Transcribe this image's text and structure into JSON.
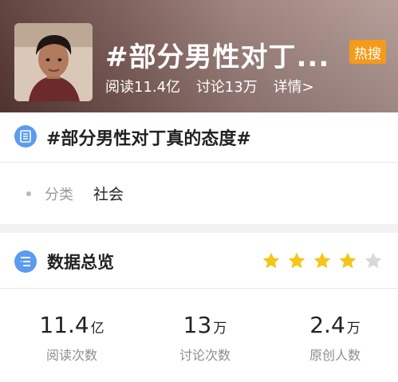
{
  "header": {
    "title": "#部分男性对丁...",
    "badge": "热搜",
    "reads": "阅读11.4亿",
    "discussions": "讨论13万",
    "details": "详情>"
  },
  "topic": {
    "name": "#部分男性对丁真的态度#",
    "category_label": "分类",
    "category_value": "社会"
  },
  "overview": {
    "title": "数据总览",
    "rating": {
      "filled": 4,
      "total": 5
    },
    "metrics": [
      {
        "value": "11.4",
        "unit": "亿",
        "label": "阅读次数"
      },
      {
        "value": "13",
        "unit": "万",
        "label": "讨论次数"
      },
      {
        "value": "2.4",
        "unit": "万",
        "label": "原创人数"
      }
    ]
  },
  "colors": {
    "accent": "#5b9bf0",
    "badge": "#f59a1b",
    "star_on": "#f5c518",
    "star_off": "#d8d8d8"
  }
}
